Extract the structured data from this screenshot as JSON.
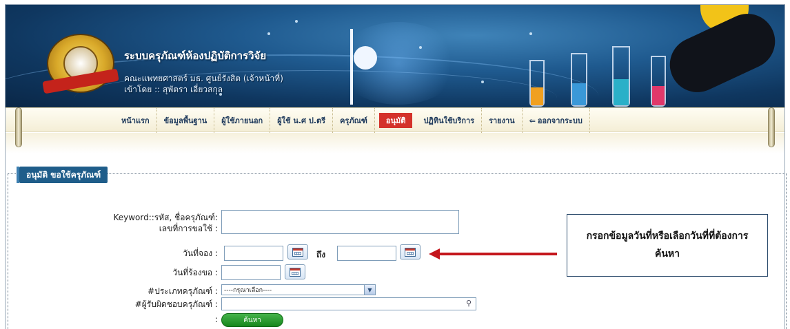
{
  "header": {
    "system_title": "ระบบครุภัณฑ์ห้องปฏิบัติการวิจัย",
    "faculty": "คณะแพทยศาสตร์ มธ. ศูนย์รังสิต (เจ้าหน้าที่)",
    "logged_in": "เข้าโดย :: สุพัตรา เอี่ยวสกุล"
  },
  "nav": {
    "items": [
      {
        "label": "หน้าแรก"
      },
      {
        "label": "ข้อมูลพื้นฐาน"
      },
      {
        "label": "ผู้ใช้ภายนอก"
      },
      {
        "label": "ผู้ใช้ น.ศ ป.ตรี"
      },
      {
        "label": "ครุภัณฑ์"
      },
      {
        "label": "อนุมัติ",
        "active": true
      },
      {
        "label": "ปฏิทินใช้บริการ"
      },
      {
        "label": "รายงาน"
      },
      {
        "label": "ออกจากระบบ"
      }
    ],
    "logout_icon": "logout-arrow-icon"
  },
  "section": {
    "title": "อนุมัติ ขอใช้ครุภัณฑ์"
  },
  "form": {
    "keyword_label": "Keyword::รหัส, ชื่อครุภัณฑ์:",
    "request_no_label": "เลขที่การขอใช้ :",
    "keyword_value": "",
    "booking_date_label": "วันที่จอง :",
    "booking_from": "",
    "to_label": "ถึง",
    "booking_to": "",
    "request_date_label": "วันที่ร้องขอ :",
    "request_date": "",
    "category_label": "#ประเภทครุภัณฑ์ :",
    "category_selected": "----กรุณาเลือก----",
    "responsible_label": "#ผู้รับผิดชอบครุภัณฑ์ :",
    "responsible_value": "",
    "submit_prefix": ":",
    "search_button": "ค้นหา"
  },
  "callout": {
    "text": "กรอกข้อมูลวันที่หรือเลือกวันที่ที่ต้องการค้นหา"
  },
  "colors": {
    "banner": "#1f5a8f",
    "active_tab": "#d4322a",
    "legend": "#1f5d8a",
    "search_button": "#1f9a25",
    "arrow": "#c4161c"
  }
}
